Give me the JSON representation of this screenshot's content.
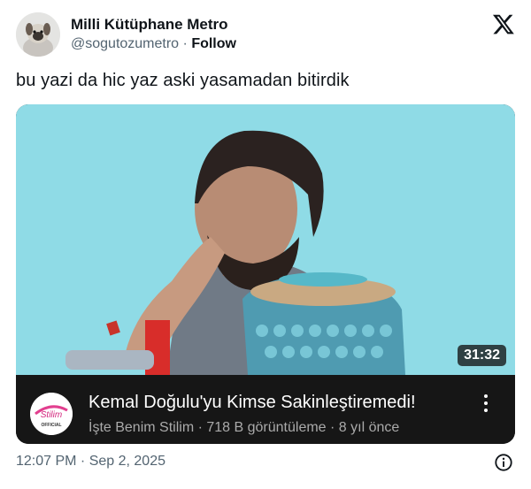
{
  "author": {
    "display_name": "Milli Kütüphane Metro",
    "handle": "@sogutozumetro",
    "separator": "·",
    "follow_label": "Follow",
    "avatar_icon": "dog-avatar"
  },
  "brand_icon": "x-logo-icon",
  "tweet": {
    "text": "bu yazi da hic yaz aski yasamadan bitirdik"
  },
  "video_card": {
    "duration": "31:32",
    "title": "Kemal Doğulu'yu Kimse Sakinleştiremedi!",
    "channel": "İşte Benim Stilim",
    "views": "718 B görüntüleme",
    "age": "8 yıl önce",
    "meta_separator": " · ",
    "channel_logo_text": "Stilim",
    "channel_logo_subtext": "OFFICIAL",
    "more_icon": "kebab-menu-icon"
  },
  "footer": {
    "timestamp": "12:07 PM · Sep 2, 2025",
    "info_icon": "info-icon"
  },
  "colors": {
    "text": "#0f1419",
    "secondary": "#536471",
    "thumbnail_bg": "#8fdbe6",
    "card_info_bg": "#161616"
  }
}
